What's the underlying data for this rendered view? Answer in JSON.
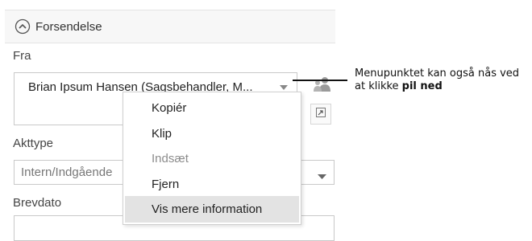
{
  "section": {
    "title": "Forsendelse",
    "collapse_icon": "chevron-up-circle-icon"
  },
  "fields": {
    "fra_label": "Fra",
    "fra_value": "Brian Ipsum Hansen (Sagsbehandler, M...",
    "akttype_label": "Akttype",
    "akttype_value": "Intern/Indgående",
    "brevdato_label": "Brevdato"
  },
  "icons": {
    "fra_dropdown": "caret-down-icon",
    "contacts": "people-icon",
    "expand": "expand-icon",
    "akttype_dropdown": "caret-down-icon"
  },
  "context_menu": {
    "items": [
      {
        "label": "Kopiér",
        "state": "enabled"
      },
      {
        "label": "Klip",
        "state": "enabled"
      },
      {
        "label": "Indsæt",
        "state": "disabled"
      },
      {
        "label": "Fjern",
        "state": "enabled"
      },
      {
        "label": "Vis mere information",
        "state": "highlighted"
      }
    ]
  },
  "callout": {
    "text_before": "Menupunktet kan også nås ved at klikke ",
    "text_bold": "pil ned"
  },
  "colors": {
    "border": "#c9c9c9",
    "header_bg": "#f7f7f7",
    "menu_highlight": "#e3e3e3",
    "disabled_text": "#8c8c8c"
  }
}
